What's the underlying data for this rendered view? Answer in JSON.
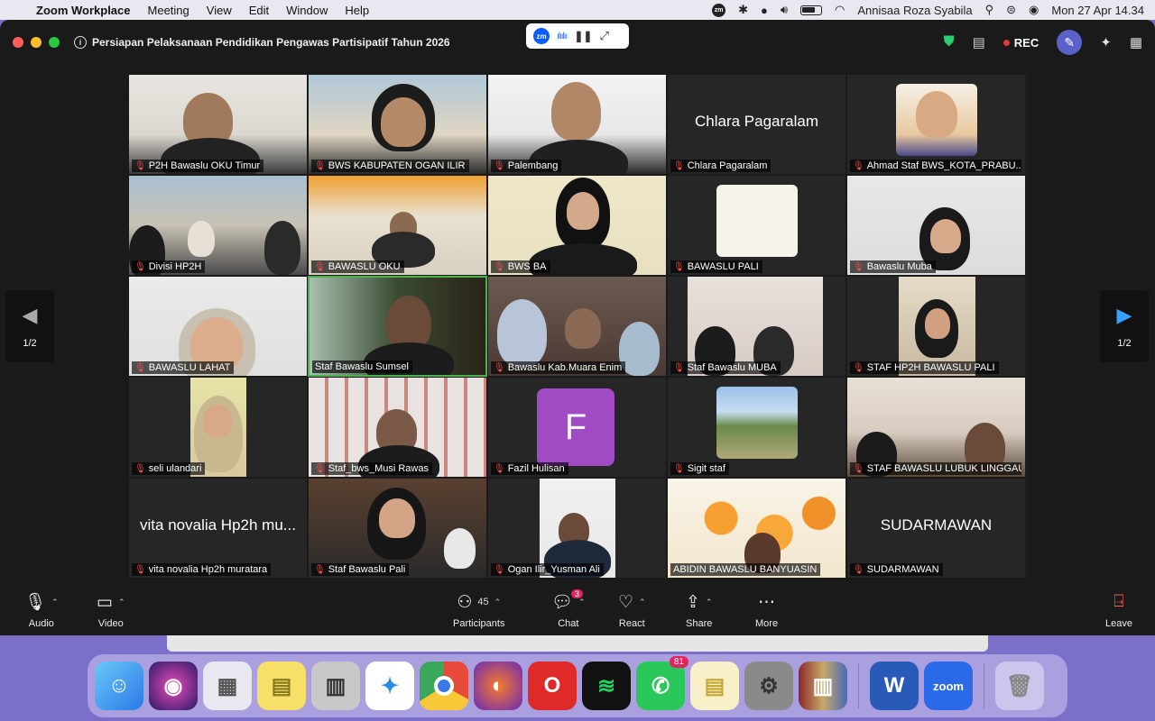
{
  "menubar": {
    "app": "Zoom Workplace",
    "items": [
      "Meeting",
      "View",
      "Edit",
      "Window",
      "Help"
    ],
    "user": "Annisaa Roza Syabila",
    "datetime": "Mon 27 Apr  14.34"
  },
  "window": {
    "title": "Persiapan Pelaksanaan Pendidikan Pengawas Partisipatif Tahun 2026",
    "rec_label": "REC"
  },
  "gallery": {
    "page": "1/2",
    "tiles": [
      {
        "name": "P2H Bawaslu OKU Timur"
      },
      {
        "name": "BWS KABUPATEN OGAN ILIR"
      },
      {
        "name": "Palembang"
      },
      {
        "name": "Chlara Pagaralam",
        "big": "Chlara Pagaralam"
      },
      {
        "name": "Ahmad Staf BWS_KOTA_PRABU..."
      },
      {
        "name": "Divisi HP2H"
      },
      {
        "name": "BAWASLU OKU"
      },
      {
        "name": "BWS BA"
      },
      {
        "name": "BAWASLU PALI"
      },
      {
        "name": "Bawaslu Muba"
      },
      {
        "name": "BAWASLU LAHAT"
      },
      {
        "name": "Staf Bawaslu Sumsel"
      },
      {
        "name": "Bawaslu Kab.Muara Enim"
      },
      {
        "name": "Staf Bawaslu MUBA"
      },
      {
        "name": "STAF HP2H BAWASLU PALI"
      },
      {
        "name": "seli ulandari"
      },
      {
        "name": "Staf_bws_Musi Rawas"
      },
      {
        "name": "Fazil Hulisan",
        "letter": "F"
      },
      {
        "name": "Sigit staf"
      },
      {
        "name": "STAF BAWASLU LUBUK LINGGAU"
      },
      {
        "name": "vita novalia Hp2h muratara",
        "big": "vita novalia Hp2h mu..."
      },
      {
        "name": "Staf Bawaslu Pali"
      },
      {
        "name": "Ogan Ilir_Yusman Ali"
      },
      {
        "name": "ABIDIN BAWASLU BANYUASIN"
      },
      {
        "name": "SUDARMAWAN",
        "big": "SUDARMAWAN"
      }
    ]
  },
  "toolbar": {
    "audio": "Audio",
    "video": "Video",
    "participants": "Participants",
    "participants_count": "45",
    "chat": "Chat",
    "chat_badge": "3",
    "react": "React",
    "share": "Share",
    "more": "More",
    "leave": "Leave"
  },
  "dock": {
    "whatsapp_badge": "81",
    "zoom_label": "zoom",
    "word_label": "W"
  }
}
